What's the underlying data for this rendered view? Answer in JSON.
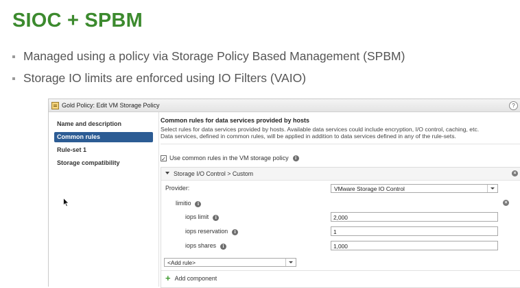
{
  "slide": {
    "title": "SIOC + SPBM",
    "bullets": [
      "Managed using a policy via Storage Policy Based Management (SPBM)",
      "Storage IO limits are enforced using IO Filters (VAIO)"
    ],
    "title_color": "#3c8a2e"
  },
  "dialog": {
    "title": "Gold Policy: Edit VM Storage Policy",
    "help": "?",
    "nav": [
      {
        "label": "Name and description",
        "active": false
      },
      {
        "label": "Common rules",
        "active": true
      },
      {
        "label": "Rule-set 1",
        "active": false
      },
      {
        "label": "Storage compatibility",
        "active": false
      }
    ],
    "content": {
      "section_title": "Common rules for data services provided by hosts",
      "desc_line1": "Select rules for data services provided by hosts. Available data services could include encryption, I/O control, caching, etc.",
      "desc_line2": "Data services, defined in common rules, will be applied in addition to data services defined in any of the rule-sets.",
      "use_common_rules_label": "Use common rules in the VM storage policy",
      "use_common_rules_checked": true,
      "rule_header": "Storage I/O Control > Custom",
      "provider_label": "Provider:",
      "provider_value": "VMware Storage IO Control",
      "limitio_label": "limitio",
      "fields": [
        {
          "label": "iops limit",
          "value": "2,000"
        },
        {
          "label": "iops reservation",
          "value": "1"
        },
        {
          "label": "iops shares",
          "value": "1,000"
        }
      ],
      "add_rule": "<Add rule>",
      "add_component": "Add component"
    },
    "accent_color": "#2c5c94"
  },
  "icons": {
    "info": "i",
    "remove": "×",
    "check": "✓",
    "plus": "+"
  }
}
